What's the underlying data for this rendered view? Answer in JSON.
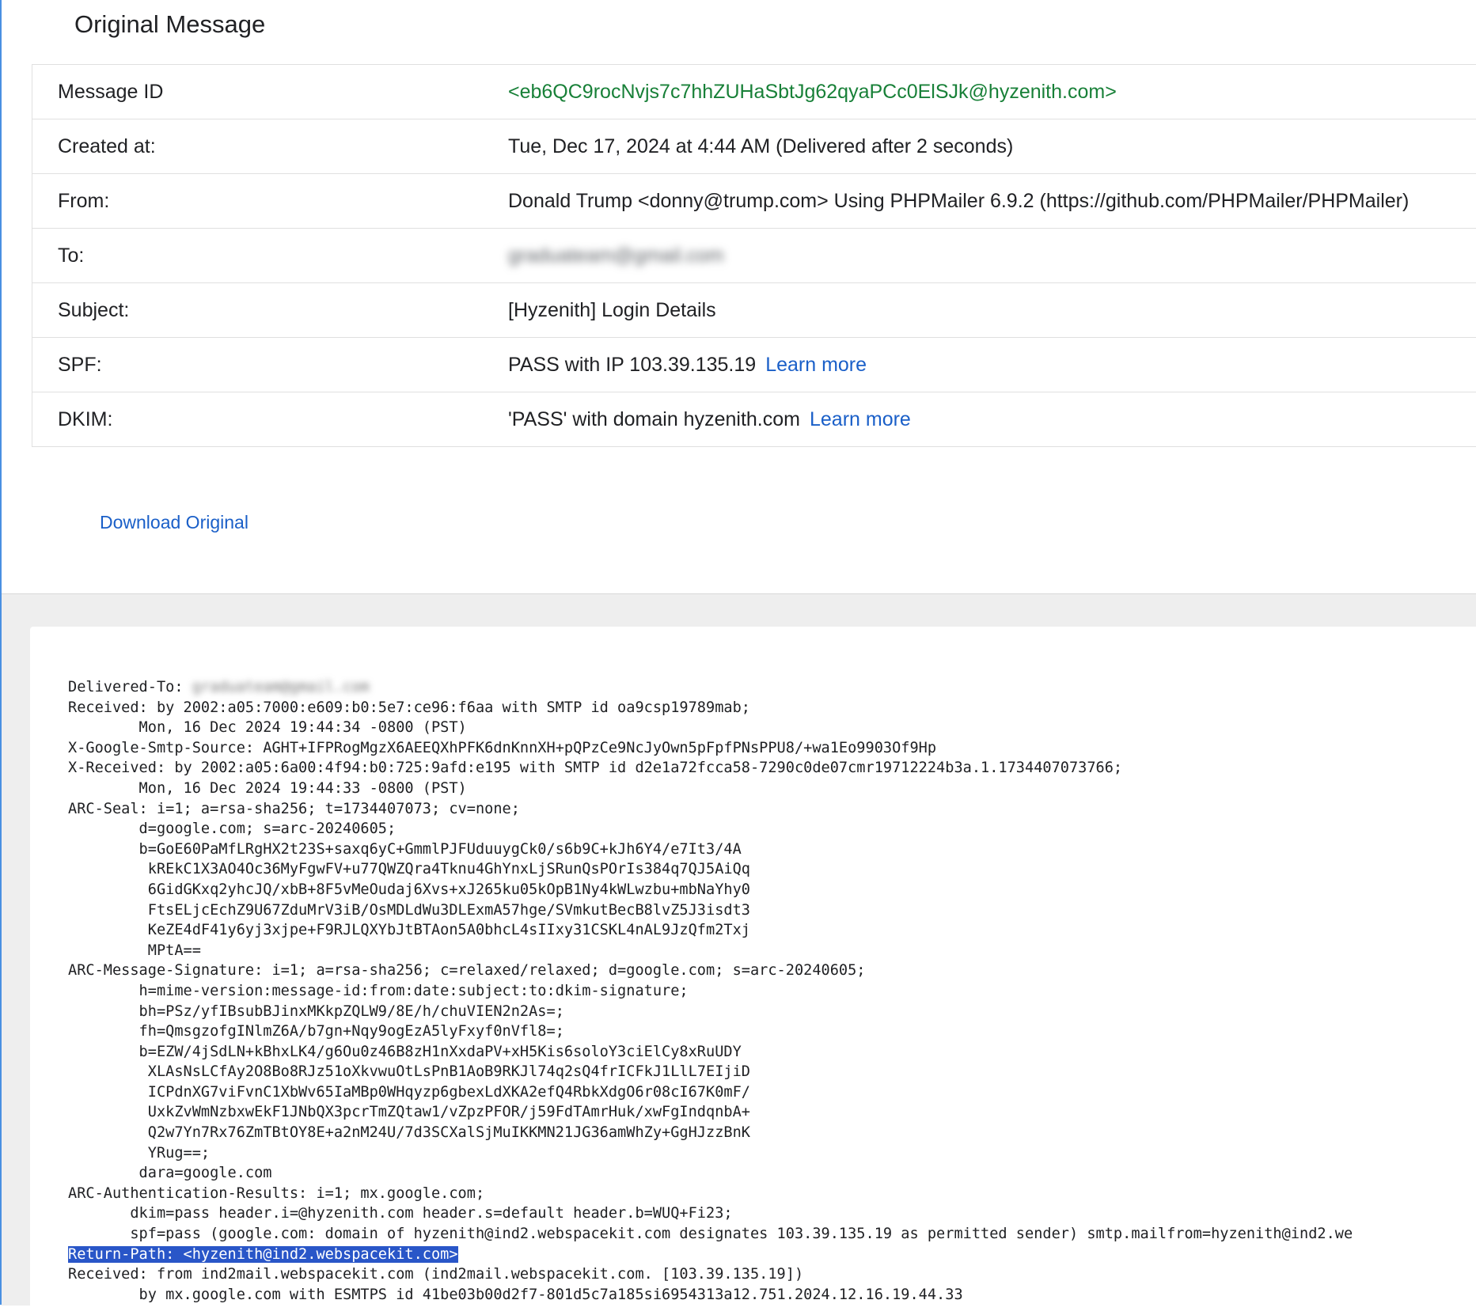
{
  "page": {
    "title": "Original Message"
  },
  "details": {
    "message_id_label": "Message ID",
    "message_id": "<eb6QC9rocNvjs7c7hhZUHaSbtJg62qyaPCc0ElSJk@hyzenith.com>",
    "created_label": "Created at:",
    "created": "Tue, Dec 17, 2024 at 4:44 AM (Delivered after 2 seconds)",
    "from_label": "From:",
    "from": "Donald Trump <donny@trump.com> Using PHPMailer 6.9.2 (https://github.com/PHPMailer/PHPMailer)",
    "to_label": "To:",
    "to": "graduateam@gmail.com",
    "subject_label": "Subject:",
    "subject": "[Hyzenith] Login Details",
    "spf_label": "SPF:",
    "spf": "PASS with IP 103.39.135.19",
    "spf_link": "Learn more",
    "dkim_label": "DKIM:",
    "dkim": "'PASS' with domain hyzenith.com",
    "dkim_link": "Learn more"
  },
  "actions": {
    "download": "Download Original"
  },
  "raw": {
    "delivered_to_label": "Delivered-To: ",
    "delivered_to": "graduateam@gmail.com",
    "block1": "Received: by 2002:a05:7000:e609:b0:5e7:ce96:f6aa with SMTP id oa9csp19789mab;\n        Mon, 16 Dec 2024 19:44:34 -0800 (PST)\nX-Google-Smtp-Source: AGHT+IFPRogMgzX6AEEQXhPFK6dnKnnXH+pQPzCe9NcJyOwn5pFpfPNsPPU8/+wa1Eo9903Of9Hp\nX-Received: by 2002:a05:6a00:4f94:b0:725:9afd:e195 with SMTP id d2e1a72fcca58-7290c0de07cmr19712224b3a.1.1734407073766;\n        Mon, 16 Dec 2024 19:44:33 -0800 (PST)\nARC-Seal: i=1; a=rsa-sha256; t=1734407073; cv=none;\n        d=google.com; s=arc-20240605;\n        b=GoE60PaMfLRgHX2t23S+saxq6yC+GmmlPJFUduuygCk0/s6b9C+kJh6Y4/e7It3/4A\n         kREkC1X3AO4Oc36MyFgwFV+u77QWZQra4Tknu4GhYnxLjSRunQsPOrIs384q7QJ5AiQq\n         6GidGKxq2yhcJQ/xbB+8F5vMeOudaj6Xvs+xJ265ku05kOpB1Ny4kWLwzbu+mbNaYhy0\n         FtsELjcEchZ9U67ZduMrV3iB/OsMDLdWu3DLExmA57hge/SVmkutBecB8lvZ5J3isdt3\n         KeZE4dF41y6yj3xjpe+F9RJLQXYbJtBTAon5A0bhcL4sIIxy31CSKL4nAL9JzQfm2Txj\n         MPtA==\nARC-Message-Signature: i=1; a=rsa-sha256; c=relaxed/relaxed; d=google.com; s=arc-20240605;\n        h=mime-version:message-id:from:date:subject:to:dkim-signature;\n        bh=PSz/yfIBsubBJinxMKkpZQLW9/8E/h/chuVIEN2n2As=;\n        fh=QmsgzofgINlmZ6A/b7gn+Nqy9ogEzA5lyFxyf0nVfl8=;\n        b=EZW/4jSdLN+kBhxLK4/g6Ou0z46B8zH1nXxdaPV+xH5Kis6soloY3ciElCy8xRuUDY\n         XLAsNsLCfAy2O8Bo8RJz51oXkvwuOtLsPnB1AoB9RKJl74q2sQ4frICFkJ1LlL7EIjiD\n         ICPdnXG7viFvnC1XbWv65IaMBp0WHqyzp6gbexLdXKA2efQ4RbkXdgO6r08cI67K0mF/\n         UxkZvWmNzbxwEkF1JNbQX3pcrTmZQtaw1/vZpzPFOR/j59FdTAmrHuk/xwFgIndqnbA+\n         Q2w7Yn7Rx76ZmTBtOY8E+a2nM24U/7d3SCXalSjMuIKKMN21JG36amWhZy+GgHJzzBnK\n         YRug==;\n        dara=google.com\nARC-Authentication-Results: i=1; mx.google.com;\n       dkim=pass header.i=@hyzenith.com header.s=default header.b=WUQ+Fi23;\n       spf=pass (google.com: domain of hyzenith@ind2.webspacekit.com designates 103.39.135.19 as permitted sender) smtp.mailfrom=hyzenith@ind2.we",
    "return_path": "Return-Path: <hyzenith@ind2.webspacekit.com>",
    "block2": "Received: from ind2mail.webspacekit.com (ind2mail.webspacekit.com. [103.39.135.19])\n        by mx.google.com with ESMTPS id 41be03b00d2f7-801d5c7a185si6954313a12.751.2024.12.16.19.44.33"
  }
}
